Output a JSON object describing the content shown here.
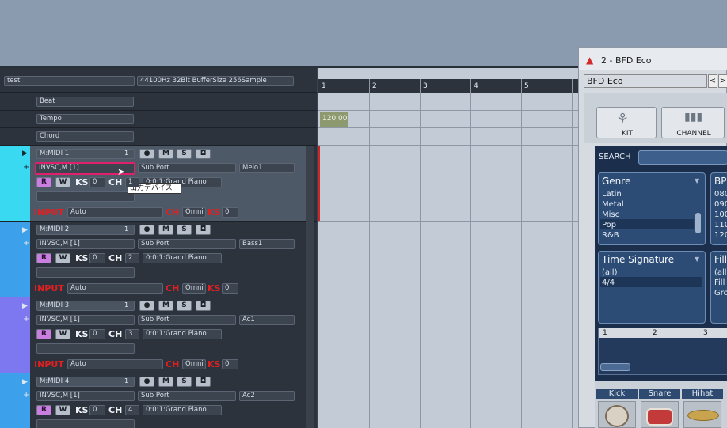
{
  "daw": {
    "project_name": "test",
    "audio_info": "44100Hz 32Bit BufferSize 256Sample",
    "global_tracks": [
      "Beat",
      "Tempo",
      "Chord"
    ],
    "ruler_marks": [
      "1",
      "2",
      "3",
      "4",
      "5"
    ],
    "tempo_value": "120.00",
    "tooltip": "出力デバイス",
    "tracks": [
      {
        "name": "M:MIDI 1",
        "number": "1",
        "port_out": "INVSC,M [1]",
        "sub_port": "Sub Port",
        "instrument": "Melo1",
        "ks": "0",
        "ch": "1",
        "program": "0:0:1:Grand Piano",
        "input": "Auto",
        "input_ch": "Omni",
        "input_ks": "0",
        "color": "#39d9f2"
      },
      {
        "name": "M:MIDI 2",
        "number": "1",
        "port_out": "INVSC,M [1]",
        "sub_port": "Sub Port",
        "instrument": "Bass1",
        "ks": "0",
        "ch": "2",
        "program": "0:0:1:Grand Piano",
        "input": "Auto",
        "input_ch": "Omni",
        "input_ks": "0",
        "color": "#3ca0ea"
      },
      {
        "name": "M:MIDI 3",
        "number": "1",
        "port_out": "INVSC,M [1]",
        "sub_port": "Sub Port",
        "instrument": "Ac1",
        "ks": "0",
        "ch": "3",
        "program": "0:0:1:Grand Piano",
        "input": "Auto",
        "input_ch": "Omni",
        "input_ks": "0",
        "color": "#7e78f0"
      },
      {
        "name": "M:MIDI 4",
        "number": "1",
        "port_out": "INVSC,M [1]",
        "sub_port": "Sub Port",
        "instrument": "Ac2",
        "ks": "0",
        "ch": "4",
        "program": "0:0:1:Grand Piano",
        "color": "#3ca0ea"
      }
    ],
    "labels": {
      "record": "R",
      "write": "W",
      "ks": "KS",
      "ch": "CH",
      "input": "INPUT",
      "mute": "M",
      "solo": "S"
    }
  },
  "bfd": {
    "window_title": "2 - BFD Eco",
    "preset": "BFD Eco",
    "kit_label": "KIT",
    "channel_label": "CHANNEL",
    "search_label": "SEARCH",
    "genre": {
      "header": "Genre",
      "items": [
        "Latin",
        "Metal",
        "Misc",
        "Pop",
        "R&B"
      ],
      "selected": "Pop"
    },
    "bpm": {
      "header": "BP",
      "items": [
        "080",
        "090",
        "100",
        "110",
        "120"
      ]
    },
    "time_signature": {
      "header": "Time Signature",
      "items": [
        "(all)",
        "4/4"
      ],
      "selected": "4/4"
    },
    "fill": {
      "header": "Fill",
      "items": [
        "(all",
        "Fill",
        "Gro"
      ]
    },
    "timeline_marks": [
      "1",
      "2",
      "3"
    ],
    "drum_tabs": [
      "Kick",
      "Snare",
      "Hihat"
    ]
  }
}
